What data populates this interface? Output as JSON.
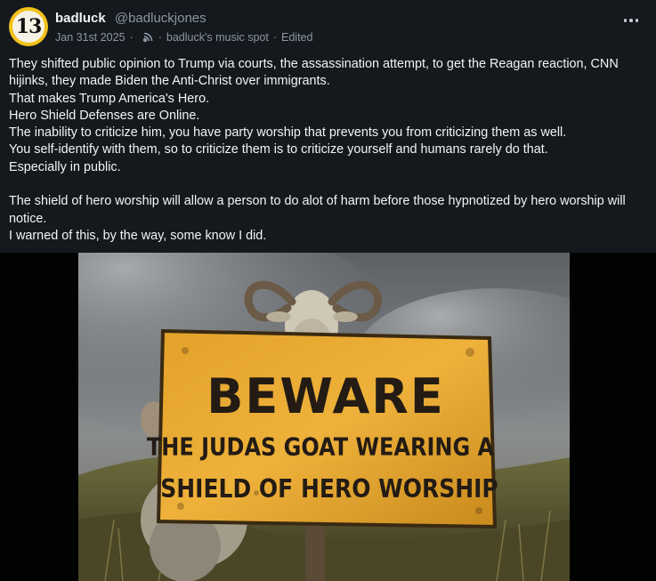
{
  "post": {
    "avatar_text": "13",
    "display_name": "badluck",
    "handle": "@badluckjones",
    "date": "Jan 31st 2025",
    "feed_icon": "feed-icon",
    "feed_name": "badluck's music spot",
    "edited_label": "Edited",
    "more_icon": "more-horizontal-icon",
    "paragraphs": [
      "They shifted public opinion to Trump via courts, the assassination attempt, to get the Reagan reaction, CNN hijinks, they made Biden the Anti-Christ over immigrants.",
      "That makes Trump America's Hero.",
      "Hero Shield Defenses are Online.",
      "The inability to criticize him, you have party worship that prevents you from criticizing them as well.",
      "You self-identify with them, so to criticize them is to criticize yourself and humans rarely do that.",
      "Especially in public.",
      "",
      "The shield of hero worship will allow a person to do alot of harm before those hypnotized by hero worship will notice.",
      "I warned of this, by the way, some know I did."
    ],
    "image": {
      "sign_line1": "BEWARE",
      "sign_line2": "THE JUDAS GOAT WEARING A",
      "sign_line3": "SHIELD OF HERO WORSHIP"
    }
  },
  "colors": {
    "background": "#15181d",
    "text": "#f2f4f5",
    "muted": "#8b98a5",
    "sign": "#e9a62a"
  }
}
